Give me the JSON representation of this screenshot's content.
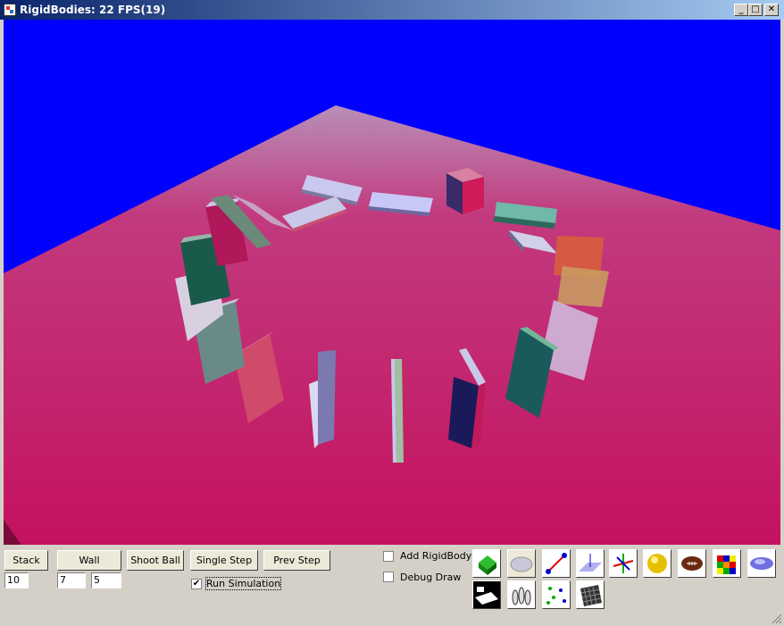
{
  "window": {
    "title": "RigidBodies: 22 FPS(19)"
  },
  "title_buttons": {
    "minimize": "_",
    "maximize": "□",
    "close": "✕"
  },
  "controls": {
    "stack_label": "Stack",
    "stack_value": "10",
    "wall_label": "Wall",
    "wall_value_a": "7",
    "wall_value_b": "5",
    "shoot_ball_label": "Shoot Ball",
    "single_step_label": "Single Step",
    "prev_step_label": "Prev Step",
    "run_simulation_label": "Run Simulation",
    "run_simulation_checked": "✔",
    "add_rigidbody_label": "Add RigidBody",
    "debug_draw_label": "Debug Draw"
  },
  "scene": {
    "sky_color": "#0000ff",
    "floor_color": "#cc1a6e"
  },
  "tools": [
    "green-box-icon",
    "disc-icon",
    "segment-icon",
    "plane-icon",
    "axes-icon",
    "sphere-icon",
    "football-icon",
    "rubiks-cube-icon",
    "ellipsoid-icon",
    "terrain-icon",
    "bowling-pins-icon",
    "particles-icon",
    "wall-grid-icon"
  ]
}
